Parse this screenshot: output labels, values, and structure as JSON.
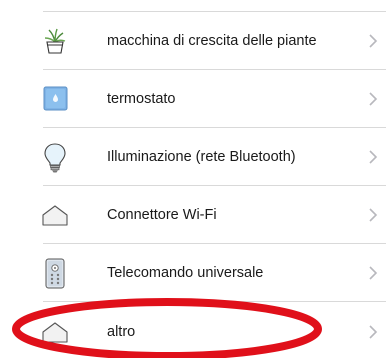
{
  "devices": {
    "items": [
      {
        "label": "macchina di crescita delle piante",
        "icon": "plant-pot-icon"
      },
      {
        "label": "termostato",
        "icon": "thermostat-icon"
      },
      {
        "label": "Illuminazione (rete Bluetooth)",
        "icon": "light-bulb-icon"
      },
      {
        "label": "Connettore Wi-Fi",
        "icon": "house-icon"
      },
      {
        "label": "Telecomando universale",
        "icon": "remote-control-icon"
      },
      {
        "label": "altro",
        "icon": "house-icon"
      }
    ],
    "chevron_icon": "chevron-right-icon"
  },
  "annotation": {
    "highlighted_item": "altro",
    "color": "#e0101a"
  },
  "colors": {
    "divider": "#d9d9d9",
    "text": "#1a1a1a",
    "chevron": "#b8b8bd",
    "thermostat_tile": "#7fb3e6"
  }
}
